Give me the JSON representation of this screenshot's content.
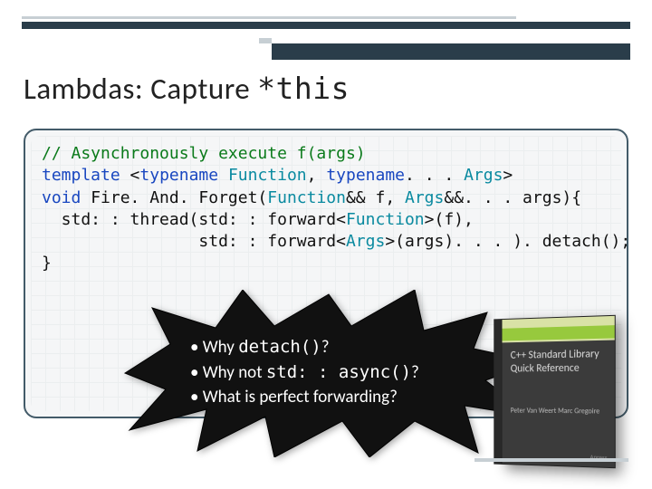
{
  "title_prefix": "Lambdas: Capture ",
  "title_mono": "*this",
  "code": {
    "l1": "// Asynchronously execute f(args)",
    "l2a": "template",
    "l2b": " <",
    "l2c": "typename",
    "l2d": " ",
    "l2e": "Function",
    "l2f": ", ",
    "l2g": "typename",
    "l2h": ". . . ",
    "l2i": "Args",
    "l2j": ">",
    "l3a": "void",
    "l3b": " Fire. And. Forget(",
    "l3c": "Function",
    "l3d": "&& f, ",
    "l3e": "Args",
    "l3f": "&&. . . args){",
    "l4a": "  std: : thread(std: : forward<",
    "l4b": "Function",
    "l4c": ">(f),",
    "l5a": "                std: : forward<",
    "l5b": "Args",
    "l5c": ">(args). . . ). detach();",
    "l6": "}"
  },
  "bullets": {
    "b1a": "Why ",
    "b1b": "detach()",
    "b1c": "?",
    "b2a": "Why not ",
    "b2b": "std: : async()",
    "b2c": "?",
    "b3": "What is perfect forwarding?"
  },
  "book": {
    "band": "",
    "title": "C++ Standard Library Quick Reference",
    "authors": "Peter Van Weert\nMarc Gregoire",
    "publisher": "Apress"
  }
}
